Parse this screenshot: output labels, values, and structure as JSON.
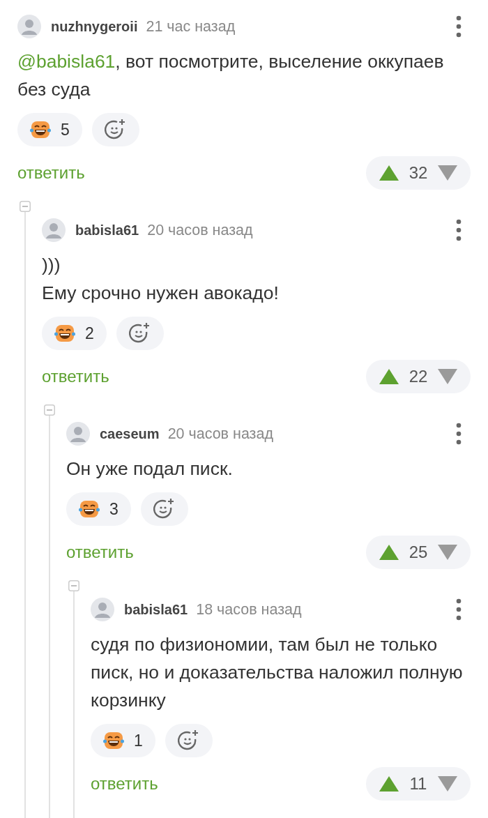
{
  "comments": [
    {
      "author": "nuzhnygeroii",
      "time": "21 час назад",
      "mention": "@babisla61",
      "lines": [
        ", вот посмотрите, выселение оккупаев без суда"
      ],
      "reactions": [
        {
          "count": "5"
        }
      ],
      "reply": "ответить",
      "rating": "32",
      "collapsed": false,
      "children": [
        {
          "author": "babisla61",
          "time": "20 часов назад",
          "lines": [
            ")))",
            "Ему срочно нужен авокадо!"
          ],
          "reactions": [
            {
              "count": "2"
            }
          ],
          "reply": "ответить",
          "rating": "22",
          "collapsed": false,
          "children": [
            {
              "author": "caeseum",
              "time": "20 часов назад",
              "lines": [
                "Он уже подал писк."
              ],
              "reactions": [
                {
                  "count": "3"
                }
              ],
              "reply": "ответить",
              "rating": "25",
              "collapsed": false,
              "children": [
                {
                  "author": "babisla61",
                  "time": "18 часов назад",
                  "lines": [
                    "судя по физиономии, там был не только писк, но и доказательства наложил полную корзинку"
                  ],
                  "reactions": [
                    {
                      "count": "1"
                    }
                  ],
                  "reply": "ответить",
                  "rating": "11"
                }
              ]
            }
          ]
        }
      ]
    }
  ]
}
